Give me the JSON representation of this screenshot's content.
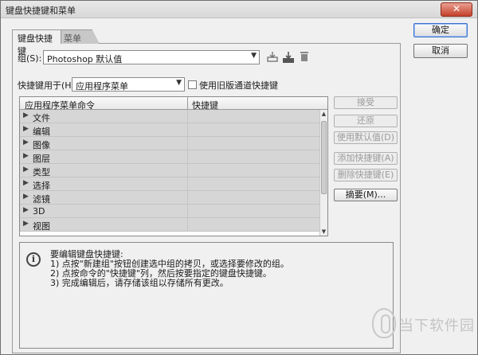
{
  "window": {
    "title": "键盘快捷键和菜单",
    "close_glyph": "✕"
  },
  "tabs": [
    {
      "label": "键盘快捷键",
      "active": true
    },
    {
      "label": "菜单",
      "active": false
    }
  ],
  "group": {
    "label": "组(S):",
    "value": "Photoshop 默认值",
    "icons": [
      "save-set-icon",
      "new-set-icon",
      "delete-set-icon"
    ]
  },
  "shortcut_for": {
    "label": "快捷键用于(H):",
    "value": "应用程序菜单",
    "legacy_checkbox_label": "使用旧版通道快捷键",
    "legacy_checked": false
  },
  "table": {
    "headers": [
      "应用程序菜单命令",
      "快捷键"
    ],
    "rows": [
      "文件",
      "编辑",
      "图像",
      "图层",
      "类型",
      "选择",
      "滤镜",
      "3D",
      "视图"
    ]
  },
  "side_buttons": [
    {
      "label": "接受",
      "enabled": false
    },
    {
      "label": "还原",
      "enabled": false
    },
    {
      "label": "使用默认值(D)",
      "enabled": false
    },
    {
      "label": "添加快捷键(A)",
      "enabled": false
    },
    {
      "label": "删除快捷键(E)",
      "enabled": false
    },
    {
      "label": "摘要(M)...",
      "enabled": true
    }
  ],
  "info": {
    "icon": "i",
    "lines": [
      "要编辑键盘快捷键:",
      "1) 点按\"新建组\"按钮创建选中组的拷贝，或选择要修改的组。",
      "2) 点按命令的\"快捷键\"列，然后按要指定的键盘快捷键。",
      "3) 完成编辑后，请存储该组以存储所有更改。"
    ]
  },
  "dialog_buttons": {
    "ok": "确定",
    "cancel": "取消"
  },
  "watermark": {
    "text": "当下软件园"
  },
  "colors": {
    "row_bg": "#d6d6d6",
    "close_red": "#c4402a",
    "default_button_border": "#3a6fd0"
  }
}
